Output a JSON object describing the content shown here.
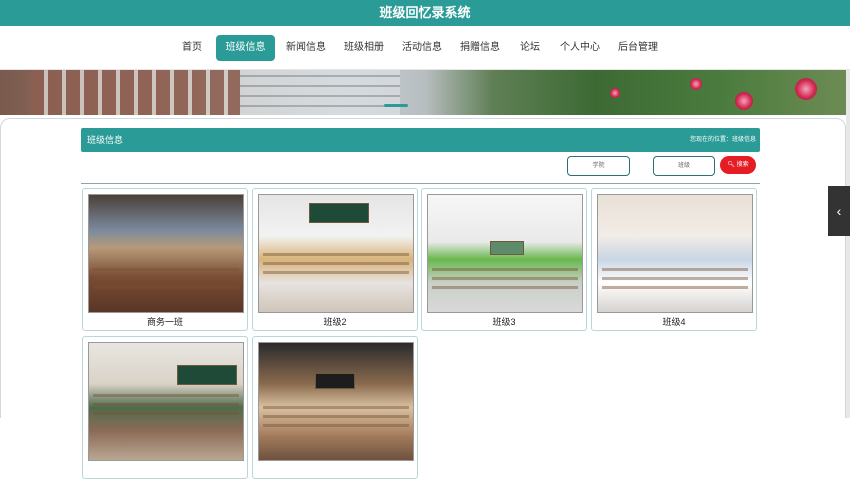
{
  "app": {
    "title": "班级回忆录系统"
  },
  "nav": {
    "items": [
      {
        "label": "首页"
      },
      {
        "label": "班级信息"
      },
      {
        "label": "新闻信息"
      },
      {
        "label": "班级相册"
      },
      {
        "label": "活动信息"
      },
      {
        "label": "捐赠信息"
      },
      {
        "label": "论坛"
      },
      {
        "label": "个人中心"
      },
      {
        "label": "后台管理"
      }
    ],
    "active_index": 1
  },
  "section": {
    "title": "班级信息",
    "breadcrumb": "您现在的位置：班级信息"
  },
  "filters": {
    "field1_placeholder": "学院",
    "field2_placeholder": "班级",
    "search_label": "搜索"
  },
  "cards": [
    {
      "name": "商务一班"
    },
    {
      "name": "班级2"
    },
    {
      "name": "班级3"
    },
    {
      "name": "班级4"
    },
    {
      "name": ""
    },
    {
      "name": ""
    }
  ],
  "colors": {
    "primary": "#2a9b96",
    "danger": "#e51c23"
  }
}
